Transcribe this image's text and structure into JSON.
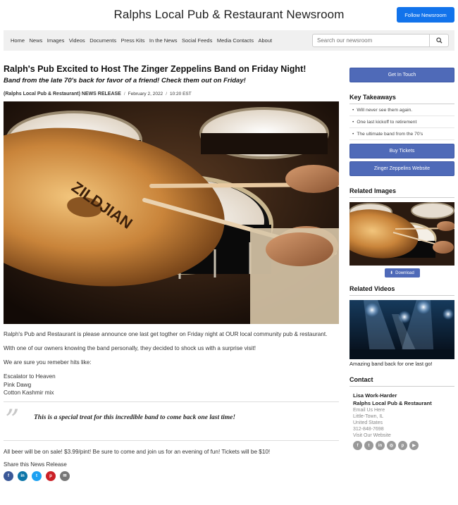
{
  "header": {
    "site_title": "Ralphs Local Pub & Restaurant Newsroom",
    "follow_label": "Follow Newsroom"
  },
  "nav": {
    "items": [
      "Home",
      "News",
      "Images",
      "Videos",
      "Documents",
      "Press Kits",
      "In the News",
      "Social Feeds",
      "Media Contacts",
      "About"
    ],
    "search_placeholder": "Search our newsroom",
    "search_icon": "search-icon"
  },
  "article": {
    "headline": "Ralph's Pub Excited to Host The Zinger Zeppelins Band on Friday Night!",
    "subhead": "Band from the late 70's back for favor of a friend! Check them out on Friday!",
    "org": "(Ralphs Local Pub & Restaurant) NEWS RELEASE",
    "separator": "/",
    "date": "February 2, 2022",
    "time": "10:20 EST",
    "paragraph1": "Ralph's Pub and Restaurant is please announce one last get togther on Friday night at OUR local community pub & restaurant.",
    "paragraph2": "With one of our owners knowing the band personally, they decided to shock us with a surprise visit!",
    "paragraph3": "We are sure you remeber hits like:",
    "hits": [
      "Escalator to Heaven",
      "Pink Dawg",
      "Cotton Kashmir mix"
    ],
    "quote_mark": "”",
    "quote": "This is a special treat for this incredible band to come back one last time!",
    "paragraph_final": "All beer will be on sale! $3.99/pint!  Be sure to come and join us for an evening of fun! Tickets will be $10!",
    "share_label": "Share this News Release",
    "share_icons": [
      {
        "name": "facebook-icon",
        "glyph": "f",
        "color": "#3b5998"
      },
      {
        "name": "linkedin-icon",
        "glyph": "in",
        "color": "#0e76a8"
      },
      {
        "name": "twitter-icon",
        "glyph": "t",
        "color": "#1da1f2"
      },
      {
        "name": "pinterest-icon",
        "glyph": "p",
        "color": "#cb2027"
      },
      {
        "name": "email-icon",
        "glyph": "✉",
        "color": "#777777"
      }
    ],
    "cymbal_brand": "ZILDJIAN"
  },
  "sidebar": {
    "get_in_touch_label": "Get In Touch",
    "key_takeaways_title": "Key Takeaways",
    "takeaways": [
      "Will never see them again.",
      "One last kickoff to retirement",
      "The ultimate band from the 70's"
    ],
    "buy_tickets_label": "Buy Tickets",
    "website_label": "Zinger Zeppelins Website",
    "related_images_title": "Related Images",
    "download_label": "Download",
    "related_videos_title": "Related Videos",
    "video_caption": "Amazing band back for one last go!",
    "contact_title": "Contact",
    "contact_name": "Lisa Work-Harder",
    "contact_org": "Ralphs Local Pub & Restaurant",
    "contact_email": "Email Us Here",
    "contact_city": "Little-Town, IL",
    "contact_country": "United States",
    "contact_phone": "312-848-7698",
    "contact_website": "Visit Our Website",
    "social_icons": [
      {
        "name": "facebook-icon",
        "glyph": "f"
      },
      {
        "name": "twitter-icon",
        "glyph": "t"
      },
      {
        "name": "linkedin-icon",
        "glyph": "in"
      },
      {
        "name": "instagram-icon",
        "glyph": "◎"
      },
      {
        "name": "pinterest-icon",
        "glyph": "p"
      },
      {
        "name": "youtube-icon",
        "glyph": "▶"
      }
    ]
  },
  "colors": {
    "accent_blue": "#1273eb",
    "button_blue": "#4f6ab8",
    "nav_bg": "#f0f0f0"
  }
}
